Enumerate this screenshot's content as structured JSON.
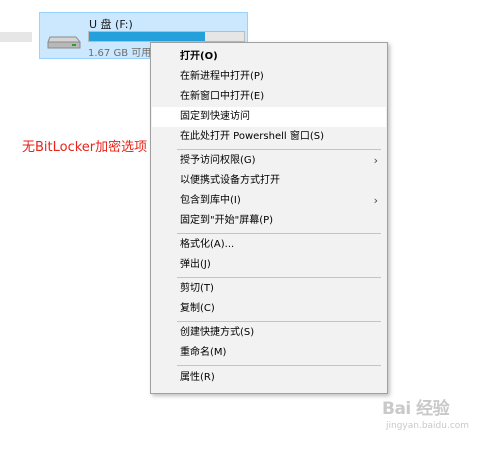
{
  "drive": {
    "name": "U 盘 (F:)",
    "size_text": "1.67 GB 可用",
    "usage_fraction": 0.75,
    "bar_fill_color": "#26a0da",
    "icon": "usb-drive-icon"
  },
  "annotation": {
    "text": "无BitLocker加密选项",
    "color": "#e8231a"
  },
  "menu": {
    "items": [
      {
        "label": "打开(O)"
      },
      {
        "label": "在新进程中打开(P)"
      },
      {
        "label": "在新窗口中打开(E)"
      },
      {
        "label": "固定到快速访问"
      },
      {
        "label": "在此处打开 Powershell 窗口(S)"
      },
      {
        "label": "授予访问权限(G)"
      },
      {
        "label": "以便携式设备方式打开"
      },
      {
        "label": "包含到库中(I)"
      },
      {
        "label": "固定到\"开始\"屏幕(P)"
      },
      {
        "label": "格式化(A)..."
      },
      {
        "label": "弹出(J)"
      },
      {
        "label": "剪切(T)"
      },
      {
        "label": "复制(C)"
      },
      {
        "label": "创建快捷方式(S)"
      },
      {
        "label": "重命名(M)"
      },
      {
        "label": "属性(R)"
      }
    ],
    "submenu_arrow": "›"
  },
  "watermark": {
    "logo_text": "Bai 经验",
    "url": "jingyan.baidu.com"
  }
}
